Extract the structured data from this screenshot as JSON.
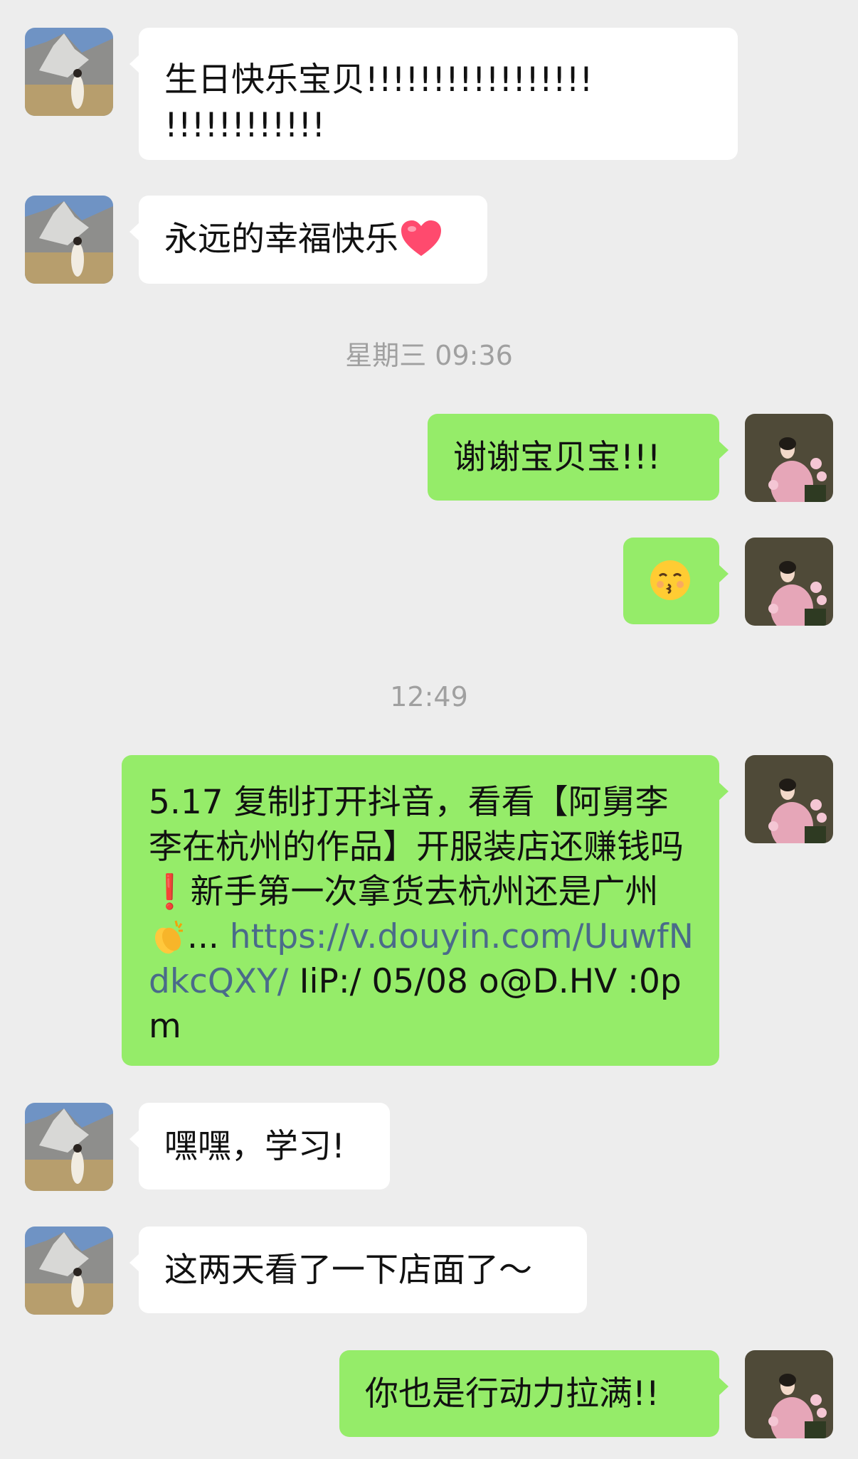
{
  "colors": {
    "background": "#ededed",
    "incoming_bubble": "#ffffff",
    "outgoing_bubble": "#95ec69",
    "timestamp_text": "#a0a0a0",
    "link_text": "#4a6b8a"
  },
  "messages": [
    {
      "side": "left",
      "text_line1": "生日快乐宝贝!!!!!!!!!!!!!!!!!",
      "text_line2": "!!!!!!!!!!!!"
    },
    {
      "side": "left",
      "text": "永远的幸福快乐",
      "emoji": "red-heart-icon"
    },
    {
      "side": "right",
      "text": "谢谢宝贝宝!!!"
    },
    {
      "side": "right",
      "emoji": "kissing-face-icon"
    },
    {
      "side": "right",
      "text_part1": "5.17 复制打开抖音，看看【阿舅李李在杭州的作品】开服装店还赚钱吗",
      "text_part2": "新手第一次拿货去杭州还是广州",
      "ellipsis": "...",
      "link": "https://v.douyin.com/UuwfNdkcQXY/",
      "text_part3": " IiP:/ 05/08 o@D.HV :0pm"
    },
    {
      "side": "left",
      "text": "嘿嘿，学习!"
    },
    {
      "side": "left",
      "text": "这两天看了一下店面了～"
    },
    {
      "side": "right",
      "text": "你也是行动力拉满!!"
    }
  ],
  "timestamps": {
    "t1": "星期三 09:36",
    "t2": "12:49"
  },
  "icons": {
    "exclamation": "❗",
    "clap": "clapping-hands-icon"
  }
}
